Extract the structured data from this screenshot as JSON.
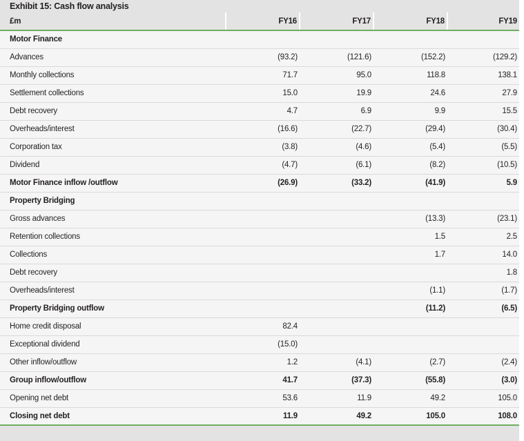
{
  "exhibit": {
    "title": "Exhibit 15: Cash flow analysis",
    "unit_label": "£m",
    "accent_green": "#6fae60",
    "header_bg": "#e3e3e3",
    "row_bg": "#f5f5f5",
    "rule_color": "#d9d9d9",
    "text_color": "#231f20"
  },
  "columns": [
    "FY16",
    "FY17",
    "FY18",
    "FY19"
  ],
  "rows": [
    {
      "label": "Motor Finance",
      "style": "section",
      "values": [
        "",
        "",
        "",
        ""
      ]
    },
    {
      "label": "Advances",
      "style": "item",
      "values": [
        "(93.2)",
        "(121.6)",
        "(152.2)",
        "(129.2)"
      ]
    },
    {
      "label": "Monthly collections",
      "style": "item",
      "values": [
        "71.7",
        "95.0",
        "118.8",
        "138.1"
      ]
    },
    {
      "label": "Settlement collections",
      "style": "item",
      "values": [
        "15.0",
        "19.9",
        "24.6",
        "27.9"
      ]
    },
    {
      "label": "Debt recovery",
      "style": "item",
      "values": [
        "4.7",
        "6.9",
        "9.9",
        "15.5"
      ]
    },
    {
      "label": "Overheads/interest",
      "style": "item",
      "values": [
        "(16.6)",
        "(22.7)",
        "(29.4)",
        "(30.4)"
      ]
    },
    {
      "label": "Corporation tax",
      "style": "item",
      "values": [
        "(3.8)",
        "(4.6)",
        "(5.4)",
        "(5.5)"
      ]
    },
    {
      "label": "Dividend",
      "style": "item",
      "values": [
        "(4.7)",
        "(6.1)",
        "(8.2)",
        "(10.5)"
      ]
    },
    {
      "label": "Motor Finance inflow /outflow",
      "style": "total",
      "values": [
        "(26.9)",
        "(33.2)",
        "(41.9)",
        "5.9"
      ]
    },
    {
      "label": "Property Bridging",
      "style": "section",
      "values": [
        "",
        "",
        "",
        ""
      ]
    },
    {
      "label": "Gross advances",
      "style": "item",
      "values": [
        "",
        "",
        "(13.3)",
        "(23.1)"
      ]
    },
    {
      "label": "Retention collections",
      "style": "item",
      "values": [
        "",
        "",
        "1.5",
        "2.5"
      ]
    },
    {
      "label": "Collections",
      "style": "item",
      "values": [
        "",
        "",
        "1.7",
        "14.0"
      ]
    },
    {
      "label": "Debt recovery",
      "style": "item",
      "values": [
        "",
        "",
        "",
        "1.8"
      ]
    },
    {
      "label": "Overheads/interest",
      "style": "item",
      "values": [
        "",
        "",
        "(1.1)",
        "(1.7)"
      ]
    },
    {
      "label": "Property Bridging outflow",
      "style": "total",
      "values": [
        "",
        "",
        "(11.2)",
        "(6.5)"
      ]
    },
    {
      "label": "Home credit disposal",
      "style": "item",
      "values": [
        "82.4",
        "",
        "",
        ""
      ]
    },
    {
      "label": "Exceptional dividend",
      "style": "item",
      "values": [
        "(15.0)",
        "",
        "",
        ""
      ]
    },
    {
      "label": "Other inflow/outflow",
      "style": "item",
      "values": [
        "1.2",
        "(4.1)",
        "(2.7)",
        "(2.4)"
      ]
    },
    {
      "label": "Group inflow/outflow",
      "style": "total",
      "values": [
        "41.7",
        "(37.3)",
        "(55.8)",
        "(3.0)"
      ]
    },
    {
      "label": "Opening net debt",
      "style": "item",
      "values": [
        "53.6",
        "11.9",
        "49.2",
        "105.0"
      ]
    },
    {
      "label": "Closing net debt",
      "style": "total",
      "values": [
        "11.9",
        "49.2",
        "105.0",
        "108.0"
      ]
    }
  ],
  "chart_data": {
    "type": "table",
    "title": "Exhibit 15: Cash flow analysis",
    "ylabel": "£m",
    "categories": [
      "FY16",
      "FY17",
      "FY18",
      "FY19"
    ],
    "series": [
      {
        "name": "Advances",
        "values": [
          -93.2,
          -121.6,
          -152.2,
          -129.2
        ]
      },
      {
        "name": "Monthly collections",
        "values": [
          71.7,
          95.0,
          118.8,
          138.1
        ]
      },
      {
        "name": "Settlement collections",
        "values": [
          15.0,
          19.9,
          24.6,
          27.9
        ]
      },
      {
        "name": "Debt recovery",
        "values": [
          4.7,
          6.9,
          9.9,
          15.5
        ]
      },
      {
        "name": "Overheads/interest",
        "values": [
          -16.6,
          -22.7,
          -29.4,
          -30.4
        ]
      },
      {
        "name": "Corporation tax",
        "values": [
          -3.8,
          -4.6,
          -5.4,
          -5.5
        ]
      },
      {
        "name": "Dividend",
        "values": [
          -4.7,
          -6.1,
          -8.2,
          -10.5
        ]
      },
      {
        "name": "Motor Finance inflow /outflow",
        "values": [
          -26.9,
          -33.2,
          -41.9,
          5.9
        ]
      },
      {
        "name": "Gross advances",
        "values": [
          null,
          null,
          -13.3,
          -23.1
        ]
      },
      {
        "name": "Retention collections",
        "values": [
          null,
          null,
          1.5,
          2.5
        ]
      },
      {
        "name": "Collections",
        "values": [
          null,
          null,
          1.7,
          14.0
        ]
      },
      {
        "name": "Debt recovery (Property Bridging)",
        "values": [
          null,
          null,
          null,
          1.8
        ]
      },
      {
        "name": "Overheads/interest (Property Bridging)",
        "values": [
          null,
          null,
          -1.1,
          -1.7
        ]
      },
      {
        "name": "Property Bridging outflow",
        "values": [
          null,
          null,
          -11.2,
          -6.5
        ]
      },
      {
        "name": "Home credit disposal",
        "values": [
          82.4,
          null,
          null,
          null
        ]
      },
      {
        "name": "Exceptional dividend",
        "values": [
          -15.0,
          null,
          null,
          null
        ]
      },
      {
        "name": "Other inflow/outflow",
        "values": [
          1.2,
          -4.1,
          -2.7,
          -2.4
        ]
      },
      {
        "name": "Group inflow/outflow",
        "values": [
          41.7,
          -37.3,
          -55.8,
          -3.0
        ]
      },
      {
        "name": "Opening net debt",
        "values": [
          53.6,
          11.9,
          49.2,
          105.0
        ]
      },
      {
        "name": "Closing net debt",
        "values": [
          11.9,
          49.2,
          105.0,
          108.0
        ]
      }
    ]
  }
}
